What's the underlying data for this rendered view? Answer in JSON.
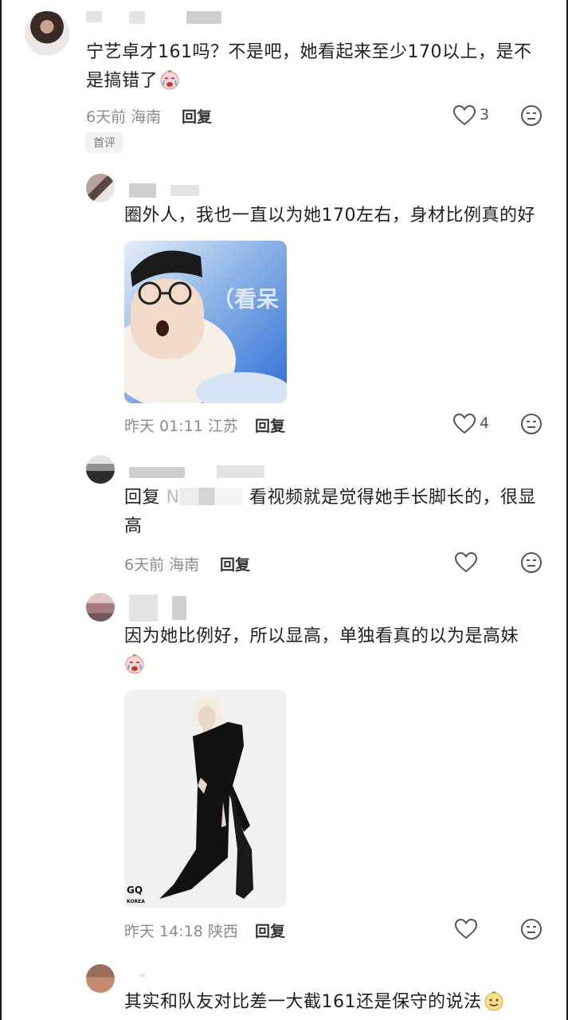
{
  "comments": [
    {
      "text_line1": "宁艺卓才161吗？不是吧，她看起来至少170以上，是不",
      "text_line2": "是搞错了",
      "time": "6天前",
      "location": "海南",
      "reply_label": "回复",
      "likes": "3",
      "badge": "首评"
    },
    {
      "text": "圈外人，我也一直以为她170左右，身材比例真的好",
      "image_overlay_text": "（看呆",
      "time": "昨天 01:11",
      "location": "江苏",
      "reply_label": "回复",
      "likes": "4"
    },
    {
      "reply_prefix": "回复",
      "reply_target": "N",
      "text_line1": "看视频就是觉得她手长脚长的，很显",
      "text_line2": "高",
      "time": "6天前",
      "location": "海南",
      "reply_label": "回复"
    },
    {
      "text_line1": "因为她比例好，所以显高，单独看真的以为是高妹",
      "image_watermark": "GQ",
      "image_watermark_sub": "KOREA",
      "time": "昨天 14:18",
      "location": "陕西",
      "reply_label": "回复"
    },
    {
      "text": "其实和队友对比差一大截161还是保守的说法"
    }
  ],
  "icons": {
    "like": "heart-outline-icon",
    "dislike": "neutral-face-icon",
    "emoji_crying": "crying-face-emoji",
    "emoji_smile": "smiling-face-emoji"
  }
}
